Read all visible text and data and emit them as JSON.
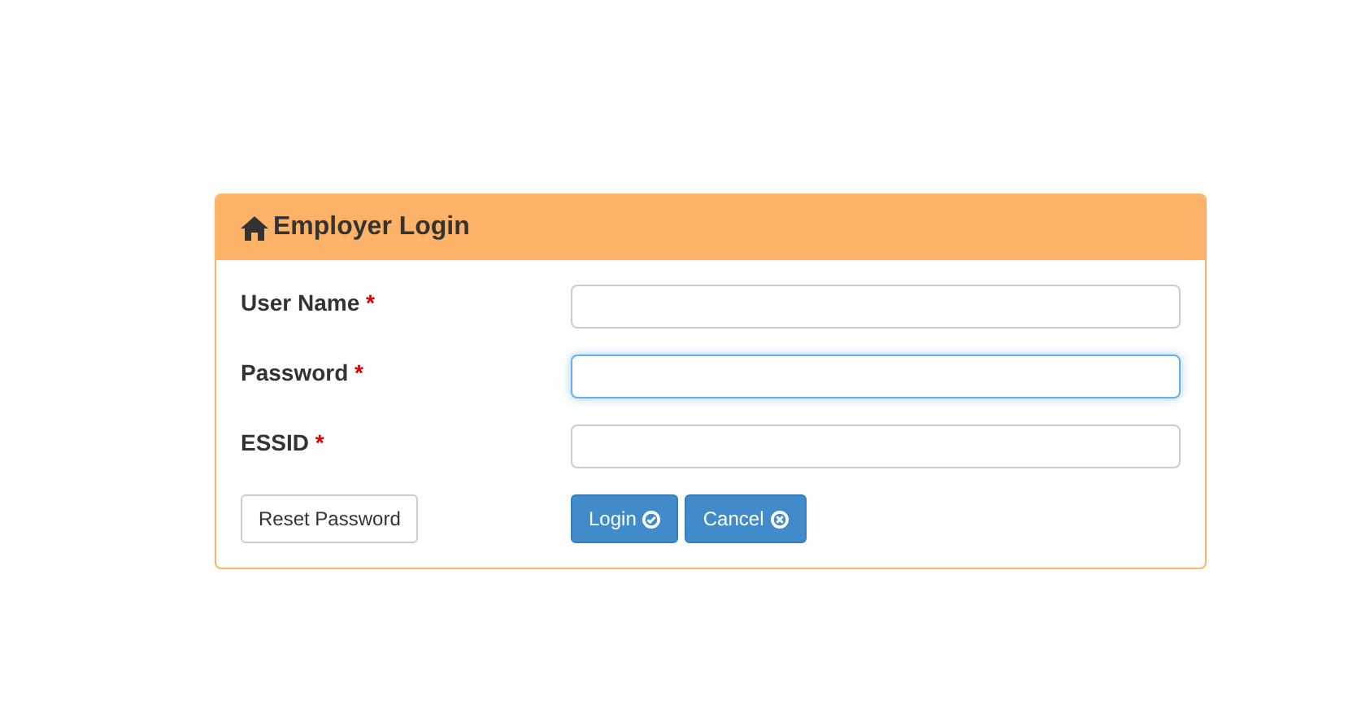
{
  "panel": {
    "title": "Employer Login"
  },
  "fields": [
    {
      "label": "User Name",
      "required_mark": "*",
      "focused": false
    },
    {
      "label": "Password",
      "required_mark": "*",
      "focused": true
    },
    {
      "label": "ESSID",
      "required_mark": "*",
      "focused": false
    }
  ],
  "secondary_button": {
    "label": "Reset Password"
  },
  "buttons": [
    {
      "label": "Login",
      "kind": "check"
    },
    {
      "label": "Cancel",
      "kind": "cross"
    }
  ]
}
